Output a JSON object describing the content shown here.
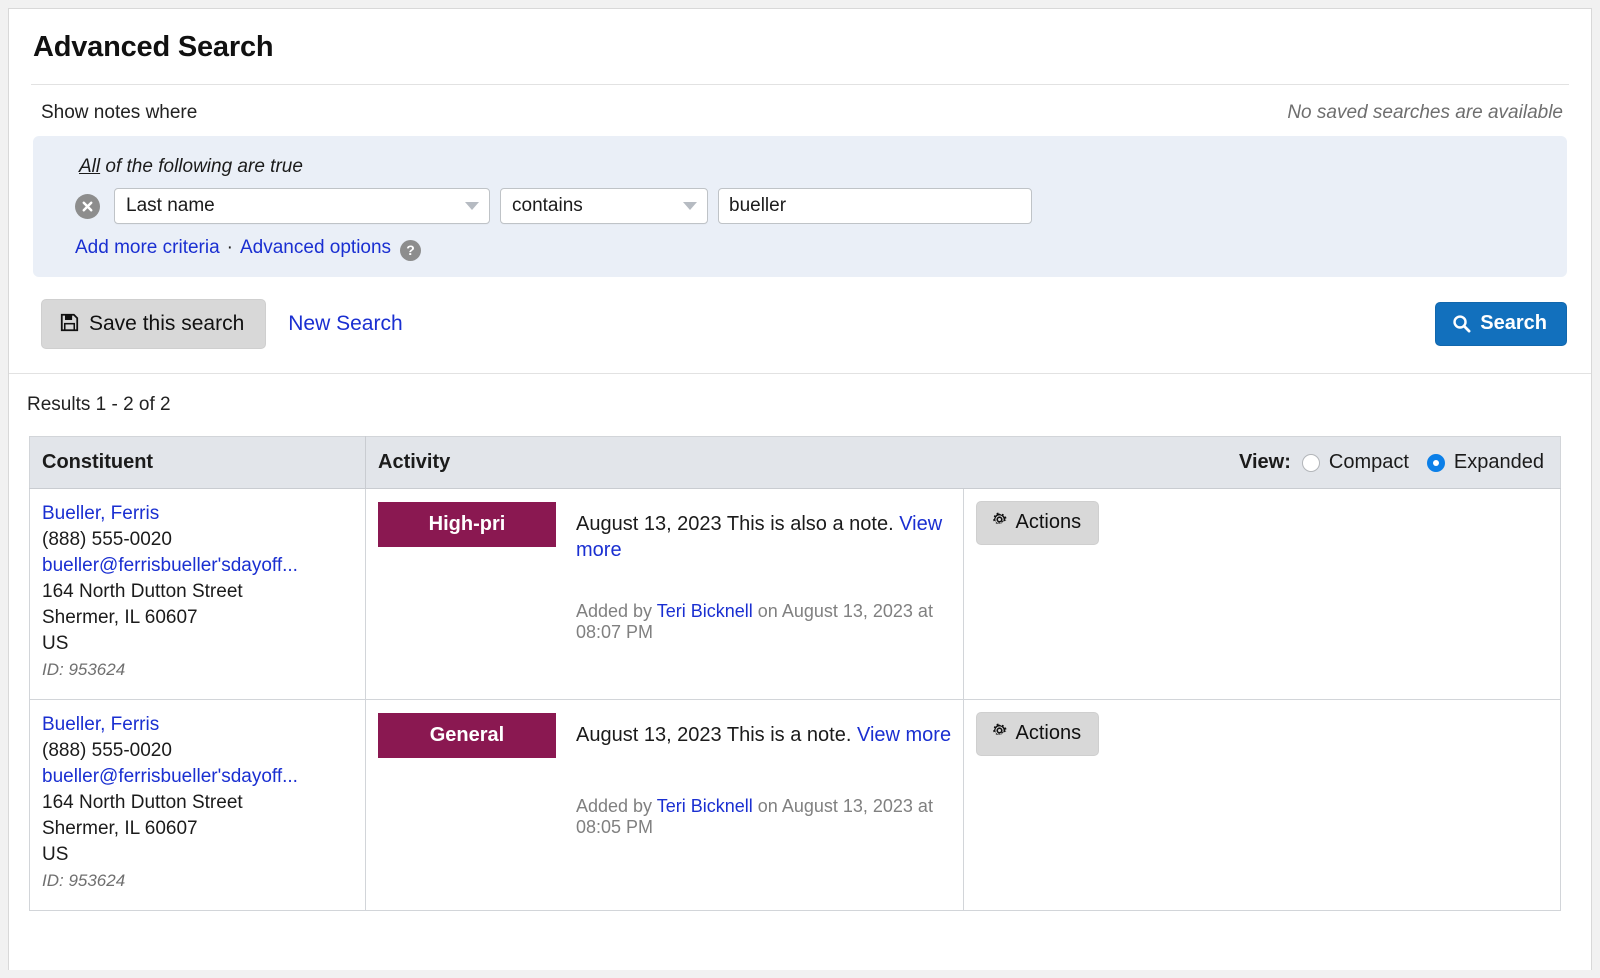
{
  "page": {
    "title": "Advanced Search"
  },
  "search": {
    "prompt": "Show notes where",
    "no_saved": "No saved searches are available",
    "all_true_prefix": "All",
    "all_true_rest": " of the following are true",
    "criteria": [
      {
        "remove_icon": "remove-circle-icon",
        "field": "Last name",
        "operator": "contains",
        "value": "bueller",
        "value_placeholder": ""
      }
    ],
    "add_more": "Add more criteria",
    "separator": "·",
    "advanced_options": "Advanced options",
    "help_icon_glyph": "?"
  },
  "toolbar": {
    "save_label": "Save this search",
    "save_icon": "floppy-disk-icon",
    "new_search_label": "New Search",
    "search_label": "Search",
    "search_icon": "magnifier-icon",
    "search_button_color": "#1270bd"
  },
  "results": {
    "count_text": "Results 1 - 2 of 2",
    "columns": {
      "constituent": "Constituent",
      "activity": "Activity"
    },
    "view": {
      "label": "View:",
      "options": [
        "Compact",
        "Expanded"
      ],
      "selected": "Expanded",
      "accent_color": "#0b7fe8"
    },
    "badge_color": "#8a1851",
    "rows": [
      {
        "constituent": {
          "name": "Bueller, Ferris",
          "phone": "(888) 555-0020",
          "email": "bueller@ferrisbueller'sdayoff...",
          "street": "164 North Dutton Street",
          "city_state_zip": "Shermer, IL 60607",
          "country": "US",
          "id": "ID: 953624"
        },
        "activity": {
          "badge": "High-pri",
          "date": "August 13, 2023",
          "note": "This is also a note.",
          "view_more": "View more",
          "added_prefix": "Added by",
          "added_user": "Teri Bicknell",
          "added_suffix": "on August 13, 2023 at 08:07 PM"
        },
        "actions_label": "Actions",
        "actions_icon": "gear-icon"
      },
      {
        "constituent": {
          "name": "Bueller, Ferris",
          "phone": "(888) 555-0020",
          "email": "bueller@ferrisbueller'sdayoff...",
          "street": "164 North Dutton Street",
          "city_state_zip": "Shermer, IL 60607",
          "country": "US",
          "id": "ID: 953624"
        },
        "activity": {
          "badge": "General",
          "date": "August 13, 2023",
          "note": "This is a note.",
          "view_more": "View more",
          "added_prefix": "Added by",
          "added_user": "Teri Bicknell",
          "added_suffix": "on August 13, 2023 at 08:05 PM"
        },
        "actions_label": "Actions",
        "actions_icon": "gear-icon"
      }
    ]
  }
}
